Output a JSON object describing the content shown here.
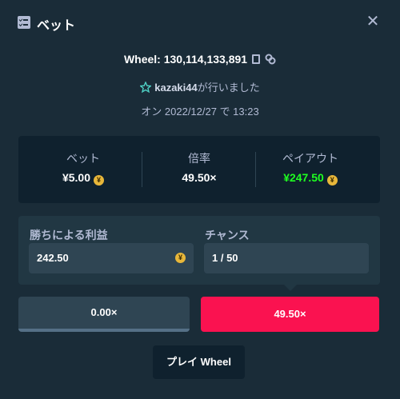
{
  "header": {
    "title": "ベット",
    "icon": "checklist-icon",
    "close_icon": "close-icon",
    "close_glyph": "✕"
  },
  "game": {
    "label": "Wheel: 130,114,133,891"
  },
  "user": {
    "name": "kazaki44",
    "suffix": "が行いました",
    "icon": "star-icon"
  },
  "date": {
    "text": "オン 2022/12/27 で 13:23"
  },
  "stats": {
    "bet_label": "ベット",
    "bet_value": "¥5.00",
    "multiplier_label": "倍率",
    "multiplier_value": "49.50×",
    "payout_label": "ペイアウト",
    "payout_value": "¥247.50",
    "payout_color": "#1fff20"
  },
  "coin_glyph": "¥",
  "params": {
    "profit_label": "勝ちによる利益",
    "profit_value": "242.50",
    "chance_label": "チャンス",
    "chance_value": "1 / 50"
  },
  "segments": {
    "left": "0.00×",
    "right": "49.50×",
    "right_color": "#fa1250"
  },
  "play_button": "プレイ Wheel"
}
